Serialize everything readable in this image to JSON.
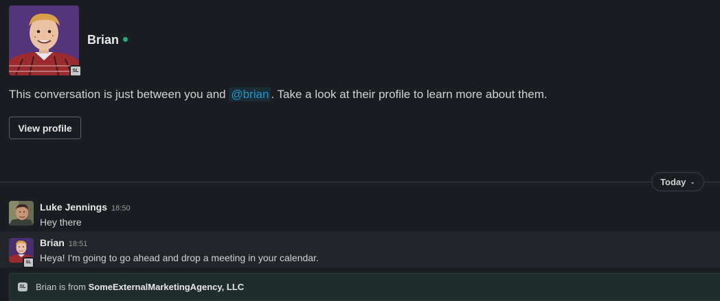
{
  "header": {
    "name": "Brian",
    "external_badge": "SL"
  },
  "intro": {
    "text_before": "This conversation is just between you and ",
    "mention": "@brian",
    "text_after": ". Take a look at their profile to learn more about them.",
    "view_profile_label": "View profile"
  },
  "divider": {
    "date_label": "Today"
  },
  "messages": [
    {
      "sender": "Luke Jennings",
      "time": "18:50",
      "text": "Hey there"
    },
    {
      "sender": "Brian",
      "time": "18:51",
      "text": "Heya! I'm going to go ahead and drop a meeting in your calendar.",
      "external_badge": "SL"
    }
  ],
  "banner": {
    "badge": "SL",
    "prefix": "Brian is from ",
    "org": "SomeExternalMarketingAgency, LLC"
  },
  "colors": {
    "background": "#1a1d21",
    "mention": "#1d9bd1",
    "presence": "#2bac76",
    "banner_bg": "#1f2d2c"
  },
  "icons": {
    "presence": "presence-dot-icon",
    "date_chevron": "chevron-down-icon",
    "external": "external-org-badge-icon"
  }
}
